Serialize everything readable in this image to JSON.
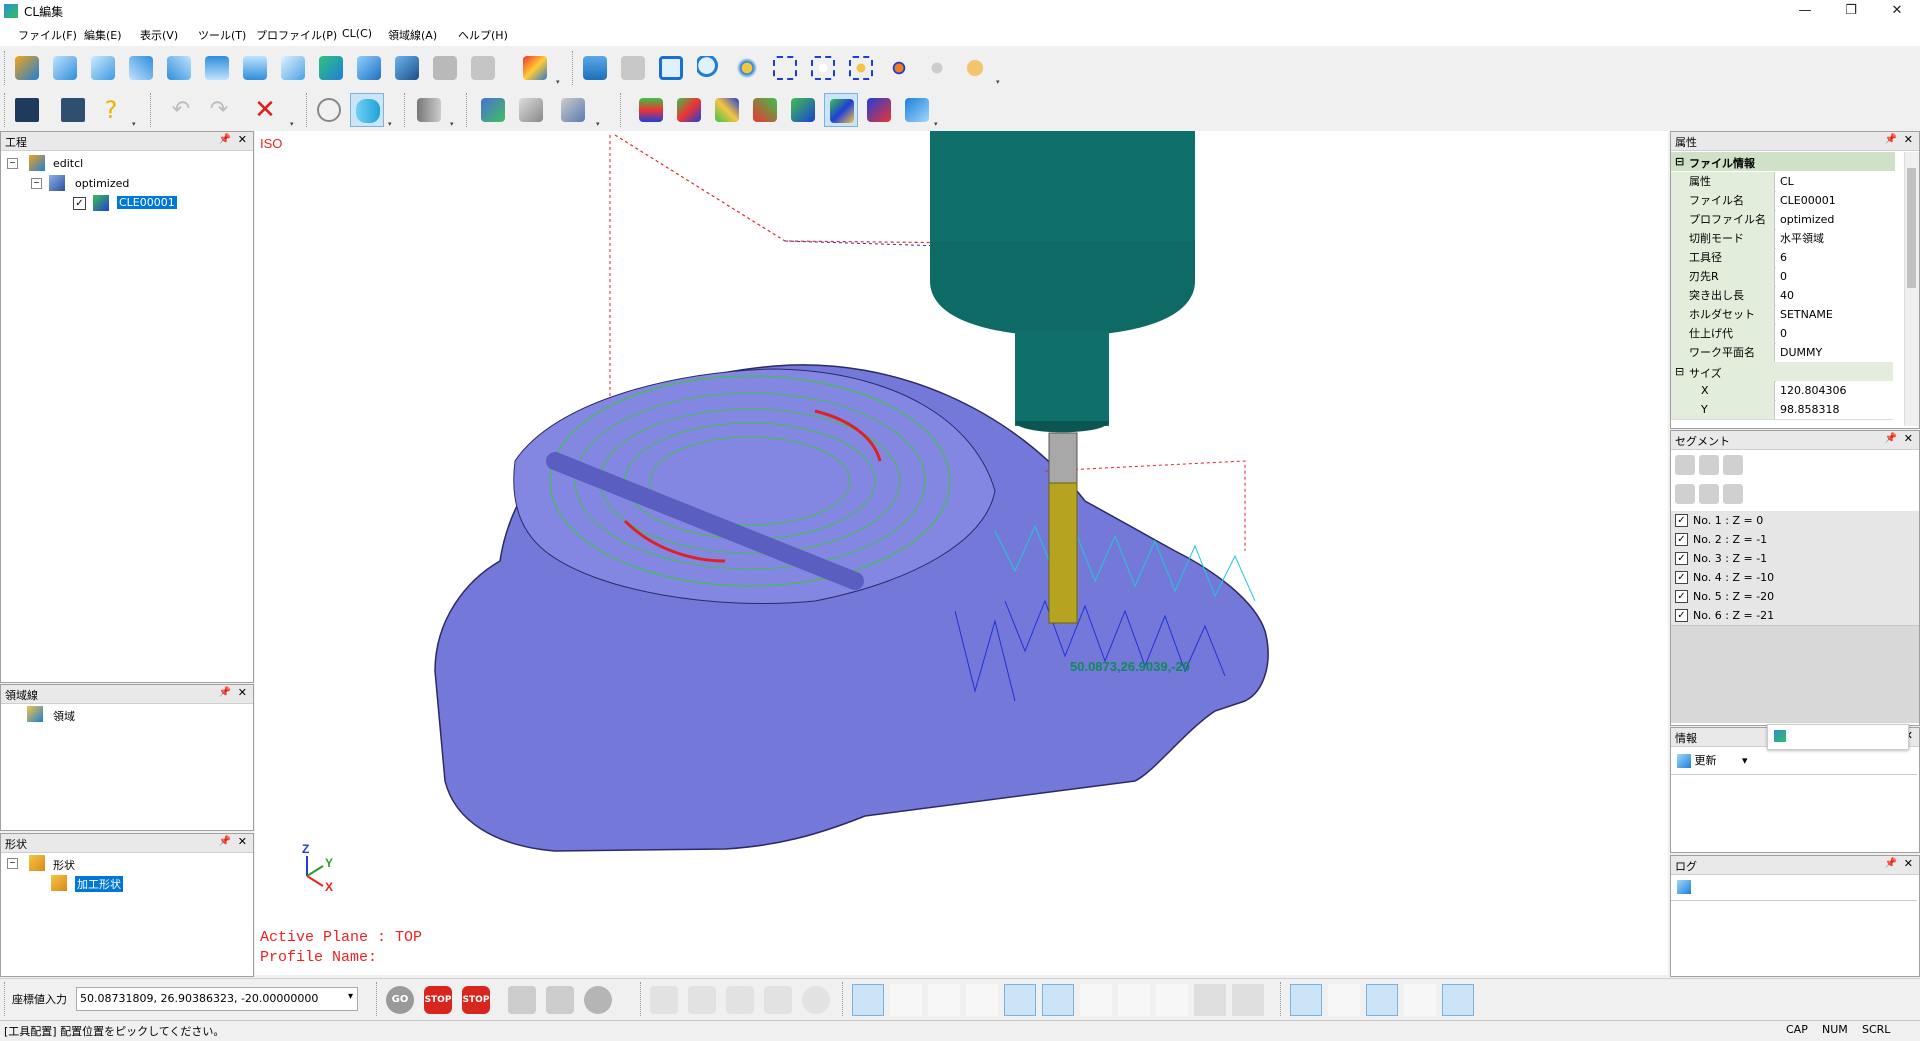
{
  "window": {
    "title": "CL編集",
    "minimize": "—",
    "maximize": "❐",
    "close": "✕"
  },
  "menu": [
    "ファイル(F)",
    "編集(E)",
    "表示(V)",
    "ツール(T)",
    "プロファイル(P)",
    "CL(C)",
    "領域線(A)",
    "ヘルプ(H)"
  ],
  "process_panel": {
    "title": "工程",
    "tree": [
      {
        "label": "editcl"
      },
      {
        "label": "optimized"
      },
      {
        "label": "CLE00001",
        "checked": true,
        "selected": true
      }
    ]
  },
  "region_panel": {
    "title": "領域線",
    "tree": [
      {
        "label": "領域"
      }
    ]
  },
  "shape_panel": {
    "title": "形状",
    "tree": [
      {
        "label": "形状"
      },
      {
        "label": "加工形状",
        "selected": true
      }
    ]
  },
  "viewport": {
    "view_label": "ISO",
    "active_plane": "Active Plane : TOP",
    "profile_name": "Profile Name:",
    "tool_coord": "50.0873,26.9039,-20",
    "axis_z": "Z",
    "axis_y": "Y",
    "axis_x": "X"
  },
  "property_panel": {
    "title": "属性",
    "section_file": "ファイル情報",
    "section_size": "サイズ",
    "rows": [
      {
        "key": "属性",
        "value": "CL"
      },
      {
        "key": "ファイル名",
        "value": "CLE00001"
      },
      {
        "key": "プロファイル名",
        "value": "optimized"
      },
      {
        "key": "切削モード",
        "value": "水平領域"
      },
      {
        "key": "工具径",
        "value": "6"
      },
      {
        "key": "刃先R",
        "value": "0"
      },
      {
        "key": "突き出し長",
        "value": "40"
      },
      {
        "key": "ホルダセット",
        "value": "SETNAME"
      },
      {
        "key": "仕上げ代",
        "value": "0"
      },
      {
        "key": "ワーク平面名",
        "value": "DUMMY"
      }
    ],
    "size_rows": [
      {
        "key": "X",
        "value": "120.804306"
      },
      {
        "key": "Y",
        "value": "98.858318"
      }
    ]
  },
  "segment_panel": {
    "title": "セグメント",
    "rows": [
      {
        "label": "No. 1 : Z = 0",
        "checked": true
      },
      {
        "label": "No. 2 : Z = -1",
        "checked": true
      },
      {
        "label": "No. 3 : Z = -1",
        "checked": true
      },
      {
        "label": "No. 4 : Z = -10",
        "checked": true
      },
      {
        "label": "No. 5 : Z = -20",
        "checked": true
      },
      {
        "label": "No. 6 : Z = -21",
        "checked": true
      }
    ]
  },
  "info_panel": {
    "title": "情報",
    "refresh_label": "更新"
  },
  "log_panel": {
    "title": "ログ"
  },
  "coord_input": {
    "label": "座標値入力",
    "value": "50.08731809, 26.90386323, -20.00000000"
  },
  "bottom_toolbar": {
    "go": "GO",
    "stop1": "STOP",
    "stop2": "STOP"
  },
  "statusbar": {
    "message": "[工具配置] 配置位置をピックしてください。",
    "cap": "CAP",
    "num": "NUM",
    "scrl": "SCRL"
  },
  "colors": {
    "selection": "#0078d7",
    "part": "#7b7fd9",
    "spindle": "#0f6f6a",
    "tool": "#b6a420"
  }
}
